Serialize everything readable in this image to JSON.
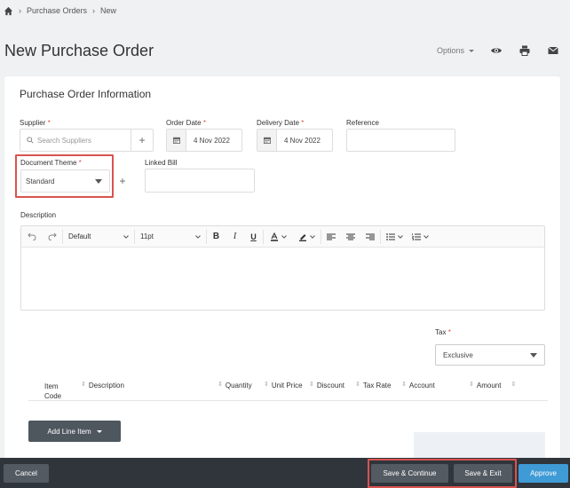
{
  "breadcrumb": {
    "home_icon": "home-icon",
    "items": [
      "Purchase Orders",
      "New"
    ]
  },
  "page": {
    "title": "New Purchase Order"
  },
  "toolbar": {
    "options_label": "Options",
    "icons": [
      "eye-icon",
      "print-icon",
      "mail-icon"
    ]
  },
  "form": {
    "section_title": "Purchase Order Information",
    "supplier": {
      "label": "Supplier",
      "placeholder": "Search Suppliers"
    },
    "order_date": {
      "label": "Order Date",
      "value": "4 Nov 2022"
    },
    "delivery_date": {
      "label": "Delivery Date",
      "value": "4 Nov 2022"
    },
    "reference": {
      "label": "Reference",
      "value": ""
    },
    "document_theme": {
      "label": "Document Theme",
      "value": "Standard"
    },
    "linked_bill": {
      "label": "Linked Bill",
      "value": ""
    },
    "description": {
      "label": "Description"
    },
    "required_marker": "*"
  },
  "editor": {
    "font_family": "Default",
    "font_size": "11pt"
  },
  "tax": {
    "label": "Tax",
    "value": "Exclusive"
  },
  "table": {
    "columns": [
      "Item Code",
      "Description",
      "Quantity",
      "Unit Price",
      "Discount",
      "Tax Rate",
      "Account",
      "Amount"
    ]
  },
  "add_line_label": "Add Line Item",
  "footer": {
    "cancel": "Cancel",
    "save_continue": "Save & Continue",
    "save_exit": "Save & Exit",
    "approve": "Approve"
  },
  "colors": {
    "accent": "#3f9bd6",
    "footer_bg": "#30353b",
    "highlight": "#d9534f",
    "required": "#d9534f"
  }
}
